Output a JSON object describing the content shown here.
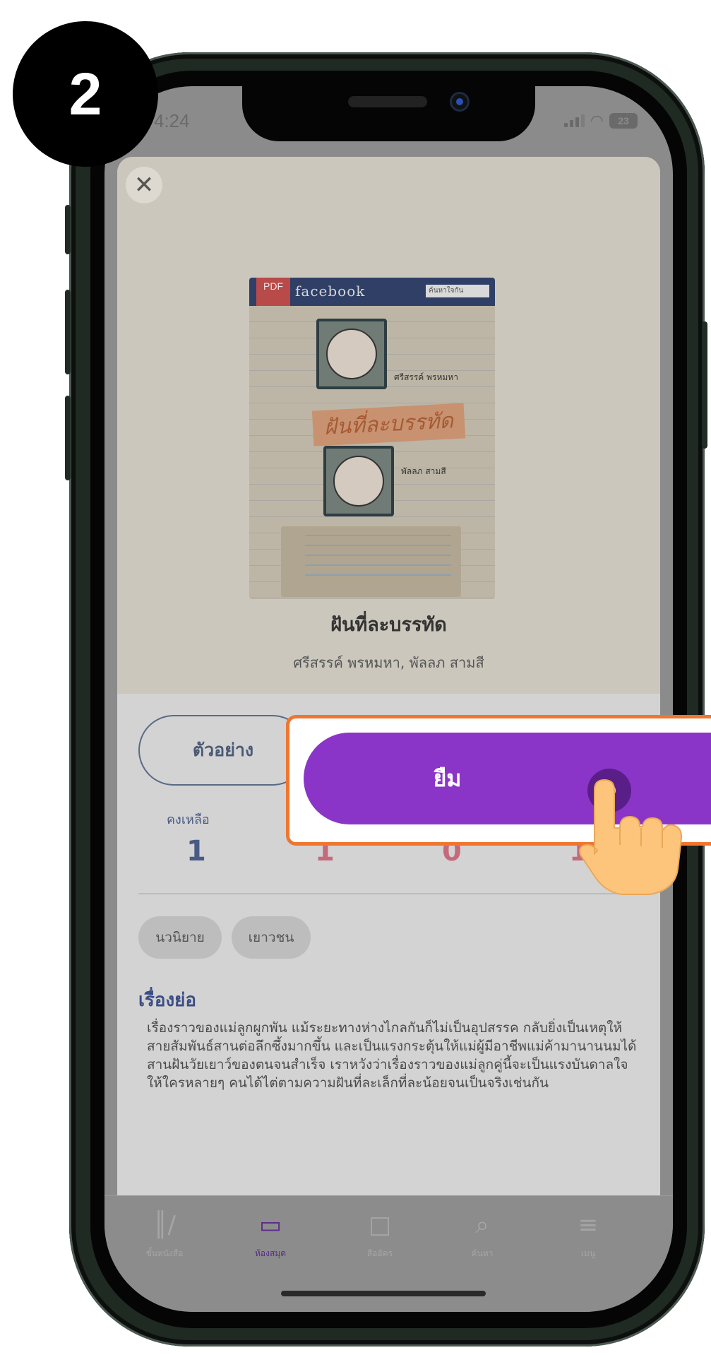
{
  "step_number": "2",
  "status_bar": {
    "time": "4:24",
    "battery": "23"
  },
  "book": {
    "title": "ฝันที่ละบรรทัด",
    "author": "ศรีสรรค์ พรหมหา, พัลลภ สามสี",
    "cover": {
      "badge": "PDF",
      "logo_text": "facebook",
      "search_text": "ค้นหาใจกัน",
      "title_art": "ฝันที่ละบรรทัด",
      "name_1": "ศรีสรรค์ พรหมหา",
      "name_2": "พัลลภ สามสี"
    }
  },
  "actions": {
    "preview_label": "ตัวอย่าง",
    "borrow_label": "ยืม"
  },
  "stats": [
    {
      "label": "คงเหลือ",
      "value": "1",
      "color": "#4a5a86"
    },
    {
      "label": "",
      "value": "1",
      "color": "#c56a7a"
    },
    {
      "label": "",
      "value": "0",
      "color": "#c56a7a"
    },
    {
      "label": "",
      "value": "1",
      "color": "#c56a7a"
    }
  ],
  "tags": [
    "นวนิยาย",
    "เยาวชน"
  ],
  "synopsis": {
    "heading": "เรื่องย่อ",
    "body": "เรื่องราวของแม่ลูกผูกพัน แม้ระยะทางห่างไกลกันก็ไม่เป็นอุปสรรค กลับยิ่งเป็นเหตุให้สายสัมพันธ์สานต่อลึกซึ้งมากขึ้น และเป็นแรงกระตุ้นให้แม่ผู้มีอาชีพแม่ค้ามานานนมได้สานฝันวัยเยาว์ของตนจนสำเร็จ เราหวังว่าเรื่องราวของแม่ลูกคู่นี้จะเป็นแรงบันดาลใจให้ใครหลายๆ คนได้ไต่ตามความฝันที่ละเล็กที่ละน้อยจนเป็นจริงเช่นกัน"
  },
  "tabbar": {
    "items": [
      {
        "label": "ชั้นหนังสือ",
        "icon": "bookshelf-icon"
      },
      {
        "label": "ห้องสมุด",
        "icon": "library-book-icon"
      },
      {
        "label": "สืออัคร",
        "icon": "book-icon"
      },
      {
        "label": "ค้นหา",
        "icon": "search-icon"
      },
      {
        "label": "เมนู",
        "icon": "menu-icon"
      }
    ]
  },
  "colors": {
    "accent_purple": "#8a35c8",
    "highlight_orange": "#f07630",
    "heading_blue": "#3b4d86"
  }
}
